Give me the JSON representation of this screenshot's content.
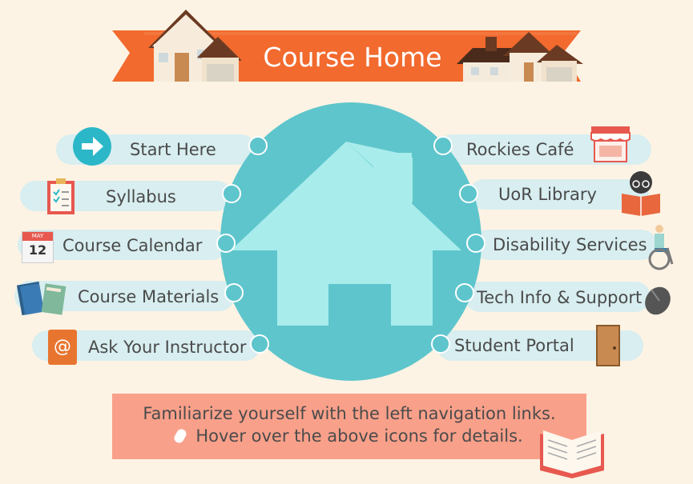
{
  "banner": {
    "title": "Course Home"
  },
  "colors": {
    "background": "#fdf3e4",
    "banner": "#f26a2e",
    "center": "#5ec5cc",
    "house": "#a8ecec",
    "pill": "#d8eef0",
    "footer": "#f9a08a"
  },
  "left_links": [
    {
      "label": "Start Here",
      "icon": "arrow-right-icon"
    },
    {
      "label": "Syllabus",
      "icon": "clipboard-icon"
    },
    {
      "label": "Course Calendar",
      "icon": "calendar-icon",
      "icon_month": "MAY",
      "icon_day": "12"
    },
    {
      "label": "Course Materials",
      "icon": "books-icon"
    },
    {
      "label": "Ask Your Instructor",
      "icon": "email-icon",
      "icon_symbol": "@"
    }
  ],
  "right_links": [
    {
      "label": "Rockies Café",
      "icon": "cafe-storefront-icon"
    },
    {
      "label": "UoR Library",
      "icon": "reading-person-icon"
    },
    {
      "label": "Disability Services",
      "icon": "wheelchair-icon"
    },
    {
      "label": "Tech Info & Support",
      "icon": "computer-mouse-icon"
    },
    {
      "label": "Student Portal",
      "icon": "door-icon"
    }
  ],
  "footer": {
    "line1": "Familiarize yourself with the left navigation links.",
    "line2": "Hover over the above icons for details."
  }
}
